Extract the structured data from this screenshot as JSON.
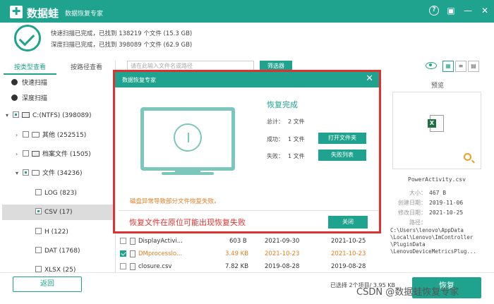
{
  "titlebar": {
    "brand": "数据蛙",
    "subtitle": "数据恢复专家",
    "buttons": [
      "?",
      "▣",
      "—",
      "✕"
    ]
  },
  "summary": {
    "quick_scan": "快速扫描已完成，已找到 138219 个文件 (15.3 GB)",
    "deep_scan": "深度扫描已完成，已找到 398089 个文件 (62.9 GB)"
  },
  "sidebar": {
    "tabs": [
      "按类型查看",
      "按路径查看"
    ],
    "scans": [
      "快速扫描",
      "深度扫描"
    ],
    "tree": [
      {
        "label": "C:(NTFS) (398089)"
      },
      {
        "label": "其他 (252515)"
      },
      {
        "label": "档案文件 (1505)"
      },
      {
        "label": "文件 (34236)"
      },
      {
        "label": "LOG (823)"
      },
      {
        "label": "CSV (17)"
      },
      {
        "label": "H (122)"
      },
      {
        "label": "DAT (1768)"
      },
      {
        "label": "XLSX (25)"
      }
    ]
  },
  "toolbar": {
    "search_placeholder": "请在此输入文件名或路径",
    "filter_label": "筛选器"
  },
  "preview": {
    "title": "预览",
    "file_name": "PowerActivity.csv",
    "meta": [
      {
        "key": "大小：",
        "value": "467 B"
      },
      {
        "key": "创建日期：",
        "value": "2019-11-06"
      },
      {
        "key": "修改日期：",
        "value": "2021-10-25"
      },
      {
        "key": "路径：",
        "value": ""
      }
    ],
    "path_lines": [
      "C:\\Users\\lenovo\\AppData",
      "\\Local\\Lenovo\\ImController",
      "\\PluginData",
      "\\LenovoDeviceMetricsPlug..."
    ]
  },
  "files": [
    {
      "name": "DisplayActivi...",
      "size": "603 B",
      "created": "2021-09-30",
      "modified": "2021-10-25",
      "checked": false
    },
    {
      "name": "DMprocesslo...",
      "size": "3.49 KB",
      "created": "2021-10-23",
      "modified": "2021-10-23",
      "checked": true
    },
    {
      "name": "closure.csv",
      "size": "7.82 KB",
      "created": "2019-08-28",
      "modified": "2019-08-28",
      "checked": false
    }
  ],
  "bottom": {
    "back_label": "返回",
    "status": "已选择 2个项目/ 3.95 KB",
    "recover_label": "恢复",
    "watermark": "CSDN @数据蛙恢复专家"
  },
  "modal": {
    "title": "数据恢复专家",
    "close": "✕",
    "result_title": "恢复完成",
    "total_label": "总计：",
    "total_value": "2 文件",
    "success_label": "成功：",
    "success_value": "1 文件",
    "fail_label": "失败：",
    "fail_value": "1 文件",
    "open_folder_label": "打开文件夹",
    "fail_list_label": "失败列表",
    "warning": "磁盘异常导致部分文件恢复失败。",
    "note": "恢复文件在原位可能出现恢复失败",
    "close_label": "关闭"
  },
  "colors": {
    "accent": "#1fa38e",
    "highlight": "#e03131",
    "warning": "#e67e22"
  }
}
